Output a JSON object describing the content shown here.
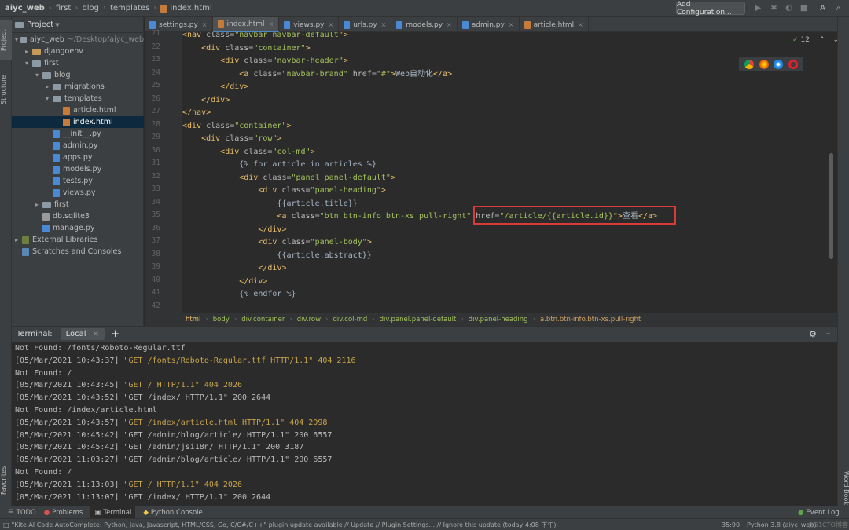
{
  "titlebar": {
    "crumbs": [
      "aiyc_web",
      "first",
      "blog",
      "templates",
      "index.html"
    ],
    "add_configuration": "Add Configuration..."
  },
  "left_tabs": {
    "project": "Project",
    "structure": "Structure",
    "favorites": "Favorites"
  },
  "right_tabs": {
    "word_book": "Word Book"
  },
  "project": {
    "header": "Project",
    "items": [
      {
        "label": "aiyc_web",
        "suffix": "~/Desktop/aiyc_web",
        "depth": 0,
        "type": "folder",
        "open": true
      },
      {
        "label": "djangoenv",
        "depth": 1,
        "type": "folder-orange",
        "open": false
      },
      {
        "label": "first",
        "depth": 1,
        "type": "folder",
        "open": true
      },
      {
        "label": "blog",
        "depth": 2,
        "type": "folder",
        "open": true
      },
      {
        "label": "migrations",
        "depth": 3,
        "type": "folder",
        "open": false
      },
      {
        "label": "templates",
        "depth": 3,
        "type": "folder",
        "open": true
      },
      {
        "label": "article.html",
        "depth": 4,
        "type": "html"
      },
      {
        "label": "index.html",
        "depth": 4,
        "type": "html",
        "selected": true
      },
      {
        "label": "__init__.py",
        "depth": 3,
        "type": "py"
      },
      {
        "label": "admin.py",
        "depth": 3,
        "type": "py"
      },
      {
        "label": "apps.py",
        "depth": 3,
        "type": "py"
      },
      {
        "label": "models.py",
        "depth": 3,
        "type": "py"
      },
      {
        "label": "tests.py",
        "depth": 3,
        "type": "py"
      },
      {
        "label": "views.py",
        "depth": 3,
        "type": "py"
      },
      {
        "label": "first",
        "depth": 2,
        "type": "folder",
        "open": false
      },
      {
        "label": "db.sqlite3",
        "depth": 2,
        "type": "db"
      },
      {
        "label": "manage.py",
        "depth": 2,
        "type": "py"
      },
      {
        "label": "External Libraries",
        "depth": 0,
        "type": "lib",
        "open": false
      },
      {
        "label": "Scratches and Consoles",
        "depth": 0,
        "type": "scratch"
      }
    ]
  },
  "tabs": [
    {
      "label": "settings.py",
      "type": "py"
    },
    {
      "label": "index.html",
      "type": "html",
      "active": true
    },
    {
      "label": "views.py",
      "type": "py"
    },
    {
      "label": "urls.py",
      "type": "py"
    },
    {
      "label": "models.py",
      "type": "py"
    },
    {
      "label": "admin.py",
      "type": "py"
    },
    {
      "label": "article.html",
      "type": "html"
    }
  ],
  "editor": {
    "inspections_count": "12",
    "line_numbers": [
      "21",
      "22",
      "23",
      "24",
      "25",
      "26",
      "27",
      "28",
      "29",
      "30",
      "31",
      "32",
      "33",
      "34",
      "35",
      "36",
      "37",
      "38",
      "39",
      "40",
      "41",
      "42"
    ],
    "lines": [
      "<nav class=\"navbar navbar-default\">",
      "    <div class=\"container\">",
      "        <div class=\"navbar-header\">",
      "            <a class=\"navbar-brand\" href=\"#\">Web自动化</a>",
      "        </div>",
      "    </div>",
      "</nav>",
      "<div class=\"container\">",
      "    <div class=\"row\">",
      "        <div class=\"col-md\">",
      "            {% for article in articles %}",
      "            <div class=\"panel panel-default\">",
      "                <div class=\"panel-heading\">",
      "                    {{article.title}}",
      "                    <a class=\"btn btn-info btn-xs pull-right\" href=\"/article/{{article.id}}\">查看</a>",
      "                </div>",
      "                <div class=\"panel-body\">",
      "                    {{article.abstract}}",
      "                </div>",
      "            </div>",
      "            {% endfor %}",
      ""
    ]
  },
  "breadcrumbs": [
    "html",
    "body",
    "div.container",
    "div.row",
    "div.col-md",
    "div.panel.panel-default",
    "div.panel-heading",
    "a.btn.btn-info.btn-xs.pull-right"
  ],
  "terminal": {
    "title": "Terminal:",
    "tab": "Local",
    "lines": [
      {
        "a": "Not Found: /fonts/Roboto-Regular.ttf",
        "b": ""
      },
      {
        "a": "[05/Mar/2021 10:43:37] ",
        "b": "\"GET /fonts/Roboto-Regular.ttf HTTP/1.1\" 404 2116",
        "warn": true
      },
      {
        "a": "Not Found: /",
        "b": ""
      },
      {
        "a": "[05/Mar/2021 10:43:45] ",
        "b": "\"GET / HTTP/1.1\" 404 2026",
        "warn": true
      },
      {
        "a": "[05/Mar/2021 10:43:52] \"GET /index/ HTTP/1.1\" 200 2644",
        "b": ""
      },
      {
        "a": "Not Found: /index/article.html",
        "b": ""
      },
      {
        "a": "[05/Mar/2021 10:43:57] ",
        "b": "\"GET /index/article.html HTTP/1.1\" 404 2098",
        "warn": true
      },
      {
        "a": "[05/Mar/2021 10:45:42] \"GET /admin/blog/article/ HTTP/1.1\" 200 6557",
        "b": ""
      },
      {
        "a": "[05/Mar/2021 10:45:42] \"GET /admin/jsi18n/ HTTP/1.1\" 200 3187",
        "b": ""
      },
      {
        "a": "[05/Mar/2021 11:03:27] \"GET /admin/blog/article/ HTTP/1.1\" 200 6557",
        "b": ""
      },
      {
        "a": "Not Found: /",
        "b": ""
      },
      {
        "a": "[05/Mar/2021 11:13:03] ",
        "b": "\"GET / HTTP/1.1\" 404 2026",
        "warn": true
      },
      {
        "a": "[05/Mar/2021 11:13:07] \"GET /index/ HTTP/1.1\" 200 2644",
        "b": ""
      }
    ]
  },
  "tool_windows": {
    "todo": "TODO",
    "problems": "Problems",
    "terminal": "Terminal",
    "python_console": "Python Console",
    "event_log": "Event Log"
  },
  "status": {
    "message": "\"Kite AI Code AutoComplete: Python, Java, Javascript, HTML/CSS, Go, C/C#/C++\" plugin update available // Update // Plugin Settings... // Ignore this update (today 4:08 下午)",
    "position": "35:90",
    "interpreter": "Python 3.8 (aiyc_web)",
    "watermark": "@51CTO博客"
  }
}
